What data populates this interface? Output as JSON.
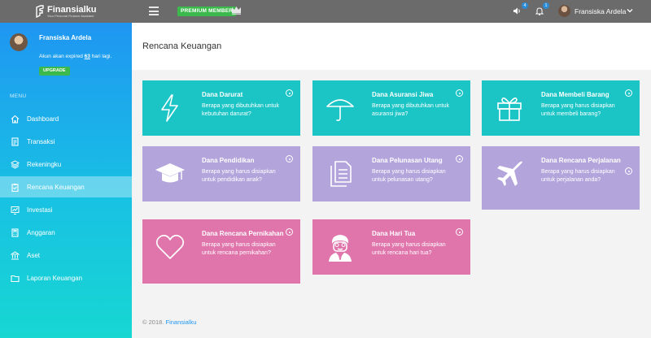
{
  "app": {
    "logo_text": "Finansialku",
    "logo_sub": "Your Personal Finance Assistant",
    "premium_label": "PREMIUM MEMBER",
    "notifications": {
      "speaker_count": "4",
      "bell_count": "1"
    },
    "user_name": "Fransiska Ardela"
  },
  "sidebar": {
    "profile_name": "Fransiska Ardela",
    "expiry_pre": "Akun akan expired ",
    "expiry_days": "63",
    "expiry_post": " hari lagi.",
    "upgrade_label": "UPGRADE",
    "menu_heading": "MENU",
    "items": [
      {
        "label": "Dashboard",
        "icon": "home-icon"
      },
      {
        "label": "Transaksi",
        "icon": "document-icon"
      },
      {
        "label": "Rekeningku",
        "icon": "layers-icon"
      },
      {
        "label": "Rencana Keuangan",
        "icon": "clipboard-icon",
        "active": true
      },
      {
        "label": "Investasi",
        "icon": "chart-icon"
      },
      {
        "label": "Anggaran",
        "icon": "calculator-icon"
      },
      {
        "label": "Aset",
        "icon": "bank-icon"
      },
      {
        "label": "Laporan Keuangan",
        "icon": "folder-icon"
      }
    ]
  },
  "main": {
    "title": "Rencana Keuangan",
    "cards": [
      {
        "title": "Dana Darurat",
        "desc": "Berapa yang dibutuhkan untuk kebutuhan darurat?",
        "icon": "lightning-icon",
        "color": "#1bc4c5"
      },
      {
        "title": "Dana Asuransi Jiwa",
        "desc": "Berapa yang dibutuhkan untuk asuransi jiwa?",
        "icon": "umbrella-icon",
        "color": "#1bc4c5"
      },
      {
        "title": "Dana Membeli Barang",
        "desc": "Berapa yang harus disiapkan untuk membeli barang?",
        "icon": "gift-icon",
        "color": "#1bc4c5"
      },
      {
        "title": "Dana Pendidikan",
        "desc": "Berapa yang harus disiapkan untuk pendidikan anak?",
        "icon": "graduation-cap-icon",
        "color": "#b4a4dc"
      },
      {
        "title": "Dana Pelunasan Utang",
        "desc": "Berapa yang harus disiapkan untuk pelunasan utang?",
        "icon": "documents-icon",
        "color": "#b4a4dc"
      },
      {
        "title": "Dana Rencana Perjalanan",
        "desc": "Berapa yang harus disiapkan untuk perjalanan anda?",
        "icon": "airplane-icon",
        "color": "#b4a4dc"
      },
      {
        "title": "Dana Rencana Pernikahan",
        "desc": "Berapa yang harus disiapkan untuk rencana pernikahan?",
        "icon": "heart-icon",
        "color": "#e075ac"
      },
      {
        "title": "Dana Hari Tua",
        "desc": "Berapa yang harus disiapkan untuk rencana hari tua?",
        "icon": "elderly-person-icon",
        "color": "#e075ac"
      }
    ]
  },
  "footer": {
    "copyright": "© 2018.",
    "brand": "Finansialku"
  }
}
